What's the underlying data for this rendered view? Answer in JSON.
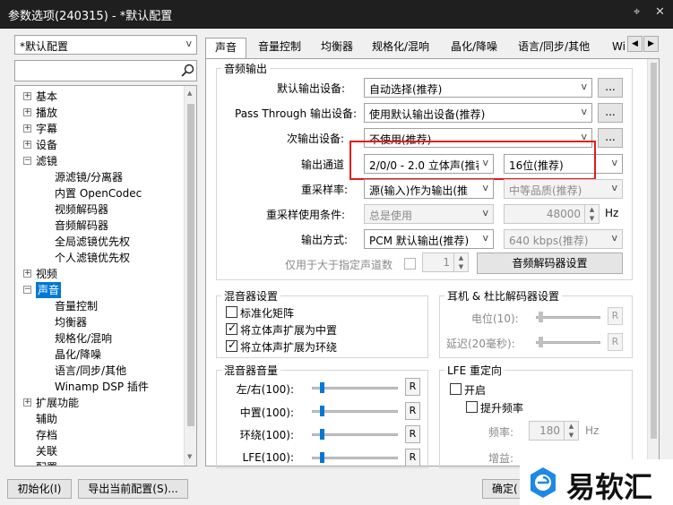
{
  "window": {
    "title": "参数选项(240315) - *默认配置",
    "close": "✕",
    "pin": "⌖"
  },
  "left": {
    "profile": "*默认配置",
    "search_placeholder": "",
    "tree": [
      {
        "label": "基本",
        "level": 0,
        "exp": "+"
      },
      {
        "label": "播放",
        "level": 0,
        "exp": "+"
      },
      {
        "label": "字幕",
        "level": 0,
        "exp": "+"
      },
      {
        "label": "设备",
        "level": 0,
        "exp": "+"
      },
      {
        "label": "滤镜",
        "level": 0,
        "exp": "-"
      },
      {
        "label": "源滤镜/分离器",
        "level": 1
      },
      {
        "label": "内置 OpenCodec",
        "level": 1
      },
      {
        "label": "视频解码器",
        "level": 1
      },
      {
        "label": "音频解码器",
        "level": 1
      },
      {
        "label": "全局滤镜优先权",
        "level": 1
      },
      {
        "label": "个人滤镜优先权",
        "level": 1
      },
      {
        "label": "视频",
        "level": 0,
        "exp": "+"
      },
      {
        "label": "声音",
        "level": 0,
        "exp": "-",
        "selected": true
      },
      {
        "label": "音量控制",
        "level": 1
      },
      {
        "label": "均衡器",
        "level": 1
      },
      {
        "label": "规格化/混响",
        "level": 1
      },
      {
        "label": "晶化/降噪",
        "level": 1
      },
      {
        "label": "语言/同步/其他",
        "level": 1
      },
      {
        "label": "Winamp DSP 插件",
        "level": 1
      },
      {
        "label": "扩展功能",
        "level": 0,
        "exp": "+"
      },
      {
        "label": "辅助",
        "level": 0
      },
      {
        "label": "存档",
        "level": 0
      },
      {
        "label": "关联",
        "level": 0
      },
      {
        "label": "配置",
        "level": 0
      }
    ]
  },
  "tabs": [
    "声音",
    "音量控制",
    "均衡器",
    "规格化/混响",
    "晶化/降噪",
    "语言/同步/其他",
    "Wi"
  ],
  "audio_output": {
    "title": "音频输出",
    "default_device_label": "默认输出设备:",
    "default_device": "自动选择(推荐)",
    "passthrough_label": "Pass Through 输出设备:",
    "passthrough": "使用默认输出设备(推荐)",
    "secondary_label": "次输出设备:",
    "secondary": "不使用(推荐)",
    "channel_label": "输出通道",
    "channel": "2/0/0 - 2.0 立体声(推荐",
    "bits": "16位(推荐)",
    "resample_label": "重采样率:",
    "resample": "源(输入)作为输出(推",
    "quality": "中等品质(推荐)",
    "resample_cond_label": "重采样使用条件:",
    "resample_cond": "总是使用",
    "freq": "48000",
    "hz": "Hz",
    "output_mode_label": "输出方式:",
    "output_mode": "PCM 默认输出(推荐)",
    "bitrate": "640 kbps(推荐)",
    "only_label": "仅用于大于指定声道数",
    "only_value": "1",
    "decoder_btn": "音频解码器设置",
    "dots": "..."
  },
  "mixer": {
    "title": "混音器设置",
    "opt1": "标准化矩阵",
    "opt2": "将立体声扩展为中置",
    "opt3": "将立体声扩展为环绕",
    "opt1_checked": false,
    "opt2_checked": true,
    "opt3_checked": true
  },
  "headphone": {
    "title": "耳机 & 杜比解码器设置",
    "level_label": "电位(10):",
    "delay_label": "延迟(20毫秒):",
    "r": "R"
  },
  "mixer_volume": {
    "title": "混音器音量",
    "rows": [
      {
        "label": "左/右(100):"
      },
      {
        "label": "中置(100):"
      },
      {
        "label": "环绕(100):"
      },
      {
        "label": "LFE(100):"
      }
    ],
    "r": "R"
  },
  "lfe": {
    "title": "LFE 重定向",
    "on_label": "开启",
    "boost_label": "提升频率",
    "freq_label": "频率:",
    "freq_value": "180",
    "hz": "Hz",
    "gain_label": "增益:"
  },
  "bottom": {
    "init_btn": "初始化(I)",
    "export_btn": "导出当前配置(S)...",
    "ok_btn": "确定("
  },
  "watermark": {
    "text": "易软汇"
  }
}
